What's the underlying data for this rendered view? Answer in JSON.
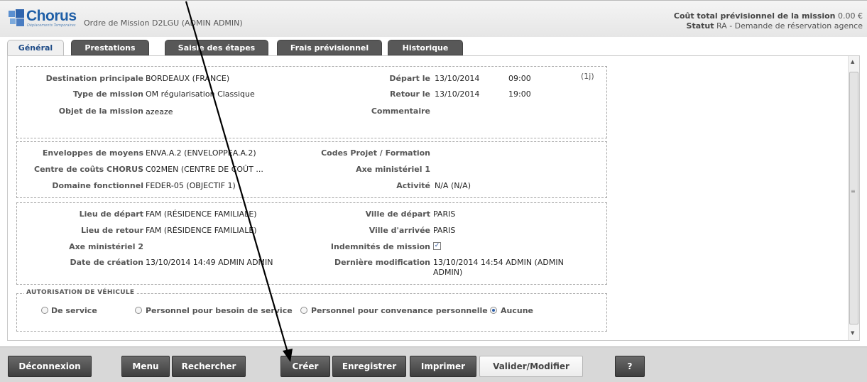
{
  "header": {
    "logo_text": "Chorus",
    "logo_sub": "Déplacements Temporaires",
    "title": "Ordre de Mission D2LGU (ADMIN ADMIN)",
    "cost_label": "Coût total prévisionnel de la mission",
    "cost_value": "0.00 €",
    "status_label": "Statut",
    "status_value": "RA - Demande de réservation agence"
  },
  "tabs": [
    "Général",
    "Prestations",
    "Saisie des étapes",
    "Frais prévisionnel",
    "Historique"
  ],
  "section1": {
    "dest_label": "Destination principale",
    "dest_value": "BORDEAUX (FRANCE)",
    "type_label": "Type de mission",
    "type_value": "OM régularisation Classique",
    "objet_label": "Objet de la mission",
    "objet_value": "azeaze",
    "depart_label": "Départ le",
    "depart_date": "13/10/2014",
    "depart_time": "09:00",
    "duration": "(1j)",
    "retour_label": "Retour le",
    "retour_date": "13/10/2014",
    "retour_time": "19:00",
    "comment_label": "Commentaire"
  },
  "section2": {
    "env_label": "Enveloppes de moyens",
    "env_value": "ENVA.A.2 (ENVELOPPEA.A.2)",
    "centre_label": "Centre de coûts CHORUS",
    "centre_value": "C02MEN (CENTRE DE COÛT ...",
    "domaine_label": "Domaine fonctionnel",
    "domaine_value": "FEDER-05 (OBJECTIF 1)",
    "codes_label": "Codes Projet / Formation",
    "axe1_label": "Axe ministériel 1",
    "activite_label": "Activité",
    "activite_value": "N/A (N/A)"
  },
  "section3": {
    "lieu_dep_label": "Lieu de départ",
    "lieu_dep_value": "FAM (RÉSIDENCE FAMILIALE)",
    "lieu_ret_label": "Lieu de retour",
    "lieu_ret_value": "FAM (RÉSIDENCE FAMILIALE)",
    "axe2_label": "Axe ministériel 2",
    "creation_label": "Date de création",
    "creation_value": "13/10/2014 14:49 ADMIN ADMIN",
    "ville_dep_label": "Ville de départ",
    "ville_dep_value": "PARIS",
    "ville_arr_label": "Ville d'arrivée",
    "ville_arr_value": "PARIS",
    "indem_label": "Indemnités de mission",
    "indem_checked": true,
    "modif_label": "Dernière modification",
    "modif_value_1": "13/10/2014 14:54 ADMIN (ADMIN",
    "modif_value_2": "ADMIN)"
  },
  "vehicle": {
    "legend": "AUTORISATION DE VÉHICULE",
    "options": [
      "De service",
      "Personnel pour besoin de service",
      "Personnel pour convenance personnelle",
      "Aucune"
    ],
    "selected": "Aucune"
  },
  "footer": {
    "buttons": [
      "Déconnexion",
      "Menu",
      "Rechercher",
      "Créer",
      "Enregistrer",
      "Imprimer",
      "Valider/Modifier",
      "?"
    ]
  },
  "colors": {
    "brand_blue": "#1f5fa7",
    "button_dark": "#4a4a4a",
    "tab_active_text": "#1d4a86"
  }
}
